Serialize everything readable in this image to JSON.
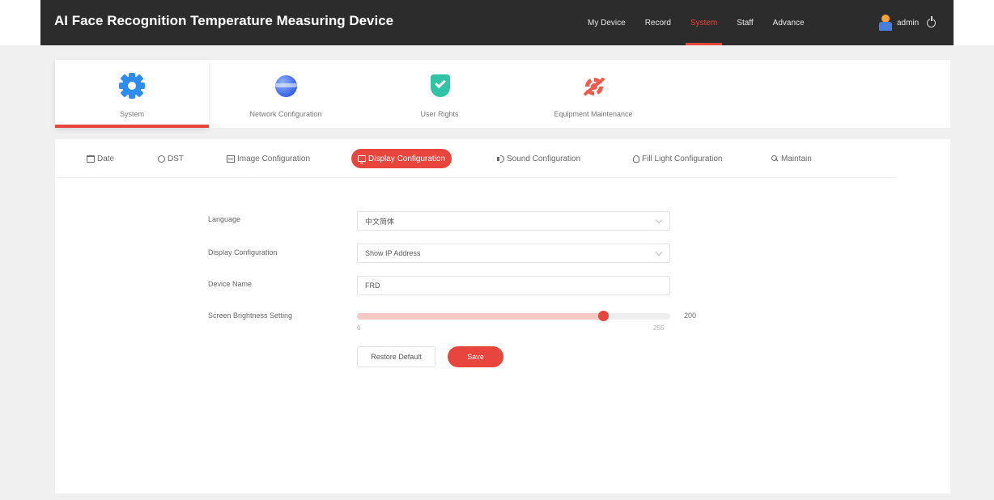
{
  "app": {
    "title": "AI Face Recognition Temperature Measuring Device"
  },
  "nav": {
    "items": [
      {
        "label": "My Device"
      },
      {
        "label": "Record"
      },
      {
        "label": "System"
      },
      {
        "label": "Staff"
      },
      {
        "label": "Advance"
      }
    ],
    "active": "System"
  },
  "user": {
    "name": "admin"
  },
  "categories": [
    {
      "label": "System",
      "icon": "gear-icon"
    },
    {
      "label": "Network Configuration",
      "icon": "globe-icon"
    },
    {
      "label": "User Rights",
      "icon": "shield-icon"
    },
    {
      "label": "Equipment Maintenance",
      "icon": "wrench-gear-icon"
    }
  ],
  "tabs": [
    {
      "label": "Date",
      "icon": "calendar-icon"
    },
    {
      "label": "DST",
      "icon": "sun-icon"
    },
    {
      "label": "Image Configuration",
      "icon": "image-icon"
    },
    {
      "label": "Display Configuration",
      "icon": "monitor-icon"
    },
    {
      "label": "Sound Configuration",
      "icon": "speaker-icon"
    },
    {
      "label": "Fill Light Configuration",
      "icon": "bulb-icon"
    },
    {
      "label": "Maintain",
      "icon": "wrench-icon"
    }
  ],
  "active_tab": "Display Configuration",
  "form": {
    "language": {
      "label": "Language",
      "value": "中文简体"
    },
    "display": {
      "label": "Display Configuration",
      "value": "Show IP Address"
    },
    "device_name": {
      "label": "Device Name",
      "value": "FRD"
    },
    "brightness": {
      "label": "Screen Brightness Setting",
      "value": 200,
      "min": 0,
      "max": 255
    }
  },
  "buttons": {
    "restore": "Restore Default",
    "save": "Save"
  },
  "colors": {
    "accent": "#e8453c",
    "topbar": "#2c2c2c",
    "panel": "#ffffff",
    "page": "#f0f0f0"
  }
}
